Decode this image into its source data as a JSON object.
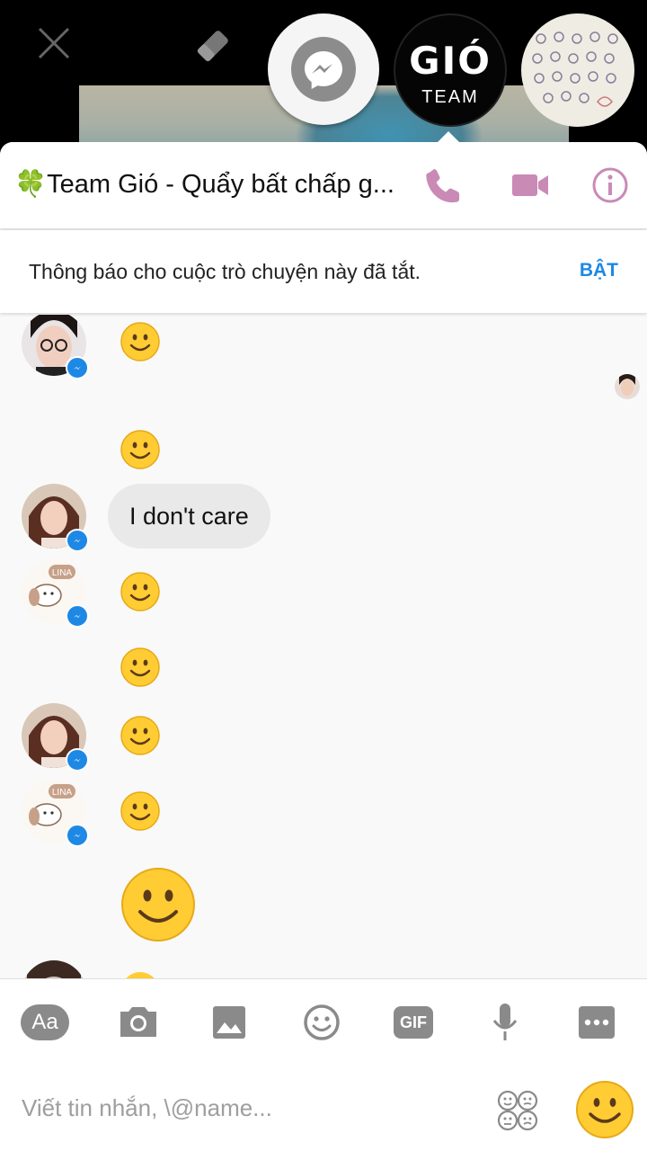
{
  "chat_heads": {
    "team_logo": "GIÓ",
    "team_label": "TEAM"
  },
  "header": {
    "title": "🍀Team Gió - Quẩy bất chấp g..."
  },
  "notice": {
    "text": "Thông báo cho cuộc trò chuyện này đã tắt.",
    "action": "BẬT"
  },
  "messages": [
    {
      "type": "emoji",
      "value": "smile"
    },
    {
      "type": "emoji",
      "value": "smile"
    },
    {
      "type": "text",
      "value": "I don't care"
    },
    {
      "type": "emoji",
      "value": "smile"
    },
    {
      "type": "emoji",
      "value": "smile"
    },
    {
      "type": "emoji",
      "value": "smile"
    },
    {
      "type": "emoji",
      "value": "smile"
    },
    {
      "type": "emoji",
      "value": "smile-large"
    }
  ],
  "avatar_badge_text": {
    "lina": "LINA"
  },
  "composer": {
    "aa_label": "Aa",
    "gif_label": "GIF",
    "placeholder": "Viết tin nhắn, \\@name..."
  },
  "colors": {
    "accent": "#c98ab6",
    "link_blue": "#1e88e5",
    "emoji_yellow": "#ffcc33"
  }
}
